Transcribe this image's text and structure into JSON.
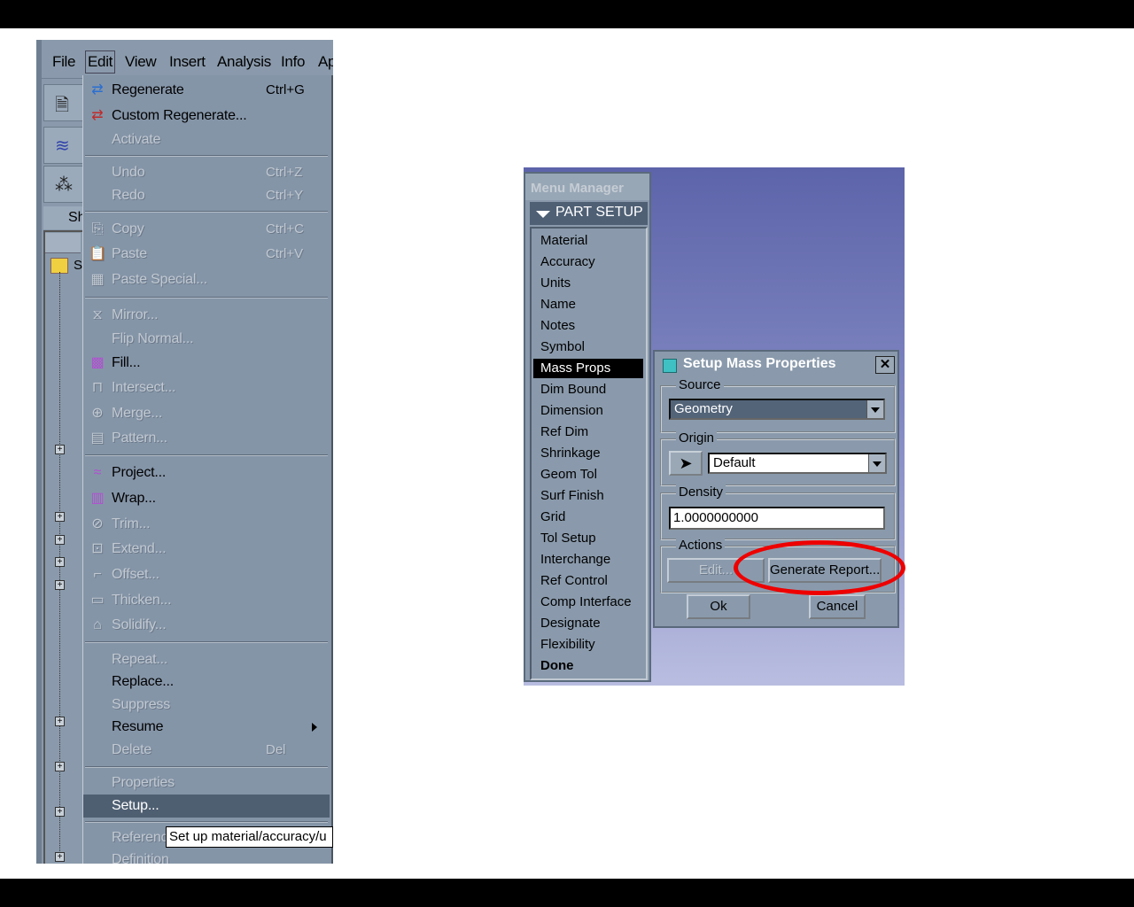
{
  "menubar": {
    "items": [
      "File",
      "Edit",
      "View",
      "Insert",
      "Analysis",
      "Info",
      "Ap"
    ]
  },
  "side_tab_label": "Sh",
  "tree_root_label": "S",
  "edit_menu": {
    "items": [
      {
        "label": "Regenerate",
        "shortcut": "Ctrl+G",
        "enabled": true,
        "icon": "regenerate-icon"
      },
      {
        "label": "Custom Regenerate...",
        "shortcut": "",
        "enabled": true,
        "icon": "custom-regenerate-icon"
      },
      {
        "label": "Activate",
        "shortcut": "",
        "enabled": false,
        "icon": ""
      },
      {
        "label": "Undo",
        "shortcut": "Ctrl+Z",
        "enabled": false,
        "icon": ""
      },
      {
        "label": "Redo",
        "shortcut": "Ctrl+Y",
        "enabled": false,
        "icon": ""
      },
      {
        "label": "Copy",
        "shortcut": "Ctrl+C",
        "enabled": false,
        "icon": "copy-icon"
      },
      {
        "label": "Paste",
        "shortcut": "Ctrl+V",
        "enabled": false,
        "icon": "paste-icon"
      },
      {
        "label": "Paste Special...",
        "shortcut": "",
        "enabled": false,
        "icon": "paste-special-icon"
      },
      {
        "label": "Mirror...",
        "shortcut": "",
        "enabled": false,
        "icon": "mirror-icon"
      },
      {
        "label": "Flip Normal...",
        "shortcut": "",
        "enabled": false,
        "icon": ""
      },
      {
        "label": "Fill...",
        "shortcut": "",
        "enabled": true,
        "icon": "fill-icon"
      },
      {
        "label": "Intersect...",
        "shortcut": "",
        "enabled": false,
        "icon": "intersect-icon"
      },
      {
        "label": "Merge...",
        "shortcut": "",
        "enabled": false,
        "icon": "merge-icon"
      },
      {
        "label": "Pattern...",
        "shortcut": "",
        "enabled": false,
        "icon": "pattern-icon"
      },
      {
        "label": "Project...",
        "shortcut": "",
        "enabled": true,
        "icon": "project-icon"
      },
      {
        "label": "Wrap...",
        "shortcut": "",
        "enabled": true,
        "icon": "wrap-icon"
      },
      {
        "label": "Trim...",
        "shortcut": "",
        "enabled": false,
        "icon": "trim-icon"
      },
      {
        "label": "Extend...",
        "shortcut": "",
        "enabled": false,
        "icon": "extend-icon"
      },
      {
        "label": "Offset...",
        "shortcut": "",
        "enabled": false,
        "icon": "offset-icon"
      },
      {
        "label": "Thicken...",
        "shortcut": "",
        "enabled": false,
        "icon": "thicken-icon"
      },
      {
        "label": "Solidify...",
        "shortcut": "",
        "enabled": false,
        "icon": "solidify-icon"
      },
      {
        "label": "Repeat...",
        "shortcut": "",
        "enabled": false,
        "icon": ""
      },
      {
        "label": "Replace...",
        "shortcut": "",
        "enabled": true,
        "icon": ""
      },
      {
        "label": "Suppress",
        "shortcut": "",
        "enabled": false,
        "icon": ""
      },
      {
        "label": "Resume",
        "shortcut": "",
        "enabled": true,
        "icon": "",
        "submenu": true
      },
      {
        "label": "Delete",
        "shortcut": "Del",
        "enabled": false,
        "icon": ""
      },
      {
        "label": "Properties",
        "shortcut": "",
        "enabled": false,
        "icon": ""
      },
      {
        "label": "Setup...",
        "shortcut": "",
        "enabled": true,
        "icon": "",
        "selected": true
      },
      {
        "label": "Referenc",
        "shortcut": "",
        "enabled": false,
        "icon": ""
      },
      {
        "label": "Definition",
        "shortcut": "",
        "enabled": false,
        "icon": ""
      }
    ],
    "tooltip": "Set up material/accuracy/u"
  },
  "menu_manager": {
    "title": "Menu Manager",
    "header": "PART SETUP",
    "items": [
      "Material",
      "Accuracy",
      "Units",
      "Name",
      "Notes",
      "Symbol",
      "Mass Props",
      "Dim Bound",
      "Dimension",
      "Ref Dim",
      "Shrinkage",
      "Geom Tol",
      "Surf Finish",
      "Grid",
      "Tol Setup",
      "Interchange",
      "Ref Control",
      "Comp Interface",
      "Designate",
      "Flexibility",
      "Done"
    ],
    "selected": "Mass Props"
  },
  "dialog": {
    "title": "Setup Mass Properties",
    "source_label": "Source",
    "source_value": "Geometry",
    "origin_label": "Origin",
    "origin_value": "Default",
    "density_label": "Density",
    "density_value": "1.0000000000",
    "actions_label": "Actions",
    "edit_button": "Edit...",
    "generate_button": "Generate Report...",
    "ok_button": "Ok",
    "cancel_button": "Cancel"
  },
  "colors": {
    "highlight_ring": "#e00000",
    "menu_bg": "#8a9aac",
    "selected_bg": "#4f5f72"
  }
}
